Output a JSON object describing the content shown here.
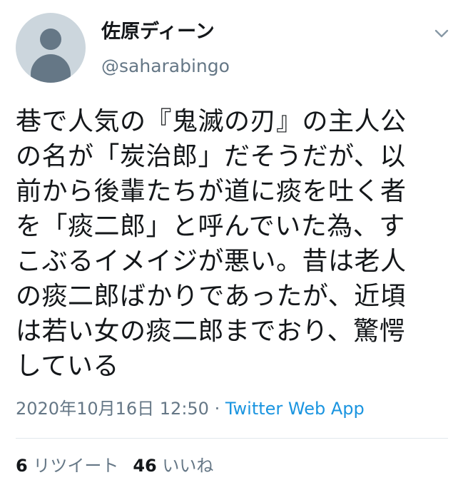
{
  "user": {
    "display_name": "佐原ディーン",
    "handle": "@saharabingo"
  },
  "tweet": {
    "lines": [
      "巷で人気の『鬼滅の刃』の主人公",
      "の名が「炭治郎」だそうだが、以",
      "前から後輩たちが道に痰を吐く者",
      "を「痰二郎」と呼んでいた為、す",
      "こぶるイメイジが悪い。昔は老人",
      "の痰二郎ばかりであったが、近頃",
      "は若い女の痰二郎までおり、驚愕",
      "している"
    ],
    "timestamp": "2020年10月16日 12:50",
    "separator": " · ",
    "source": "Twitter Web App"
  },
  "stats": {
    "retweets_count": "6",
    "retweets_label": " リツイート",
    "likes_count": "46",
    "likes_label": " いいね"
  },
  "icons": {
    "avatar": "default-profile-icon",
    "caret": "chevron-down-icon"
  },
  "colors": {
    "text": "#14171a",
    "secondary": "#657786",
    "link": "#1b95e0",
    "avatar_bg": "#ccd6dd",
    "divider": "#e1e8ed"
  }
}
